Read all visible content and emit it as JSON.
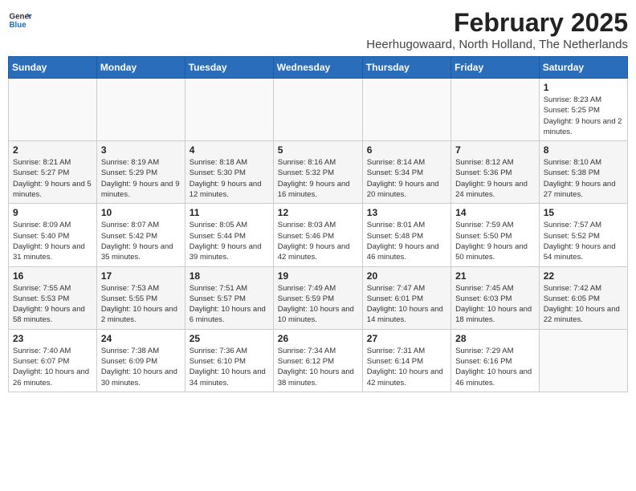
{
  "header": {
    "logo_general": "General",
    "logo_blue": "Blue",
    "main_title": "February 2025",
    "subtitle": "Heerhugowaard, North Holland, The Netherlands"
  },
  "weekdays": [
    "Sunday",
    "Monday",
    "Tuesday",
    "Wednesday",
    "Thursday",
    "Friday",
    "Saturday"
  ],
  "weeks": [
    [
      {
        "day": "",
        "info": ""
      },
      {
        "day": "",
        "info": ""
      },
      {
        "day": "",
        "info": ""
      },
      {
        "day": "",
        "info": ""
      },
      {
        "day": "",
        "info": ""
      },
      {
        "day": "",
        "info": ""
      },
      {
        "day": "1",
        "info": "Sunrise: 8:23 AM\nSunset: 5:25 PM\nDaylight: 9 hours and 2 minutes."
      }
    ],
    [
      {
        "day": "2",
        "info": "Sunrise: 8:21 AM\nSunset: 5:27 PM\nDaylight: 9 hours and 5 minutes."
      },
      {
        "day": "3",
        "info": "Sunrise: 8:19 AM\nSunset: 5:29 PM\nDaylight: 9 hours and 9 minutes."
      },
      {
        "day": "4",
        "info": "Sunrise: 8:18 AM\nSunset: 5:30 PM\nDaylight: 9 hours and 12 minutes."
      },
      {
        "day": "5",
        "info": "Sunrise: 8:16 AM\nSunset: 5:32 PM\nDaylight: 9 hours and 16 minutes."
      },
      {
        "day": "6",
        "info": "Sunrise: 8:14 AM\nSunset: 5:34 PM\nDaylight: 9 hours and 20 minutes."
      },
      {
        "day": "7",
        "info": "Sunrise: 8:12 AM\nSunset: 5:36 PM\nDaylight: 9 hours and 24 minutes."
      },
      {
        "day": "8",
        "info": "Sunrise: 8:10 AM\nSunset: 5:38 PM\nDaylight: 9 hours and 27 minutes."
      }
    ],
    [
      {
        "day": "9",
        "info": "Sunrise: 8:09 AM\nSunset: 5:40 PM\nDaylight: 9 hours and 31 minutes."
      },
      {
        "day": "10",
        "info": "Sunrise: 8:07 AM\nSunset: 5:42 PM\nDaylight: 9 hours and 35 minutes."
      },
      {
        "day": "11",
        "info": "Sunrise: 8:05 AM\nSunset: 5:44 PM\nDaylight: 9 hours and 39 minutes."
      },
      {
        "day": "12",
        "info": "Sunrise: 8:03 AM\nSunset: 5:46 PM\nDaylight: 9 hours and 42 minutes."
      },
      {
        "day": "13",
        "info": "Sunrise: 8:01 AM\nSunset: 5:48 PM\nDaylight: 9 hours and 46 minutes."
      },
      {
        "day": "14",
        "info": "Sunrise: 7:59 AM\nSunset: 5:50 PM\nDaylight: 9 hours and 50 minutes."
      },
      {
        "day": "15",
        "info": "Sunrise: 7:57 AM\nSunset: 5:52 PM\nDaylight: 9 hours and 54 minutes."
      }
    ],
    [
      {
        "day": "16",
        "info": "Sunrise: 7:55 AM\nSunset: 5:53 PM\nDaylight: 9 hours and 58 minutes."
      },
      {
        "day": "17",
        "info": "Sunrise: 7:53 AM\nSunset: 5:55 PM\nDaylight: 10 hours and 2 minutes."
      },
      {
        "day": "18",
        "info": "Sunrise: 7:51 AM\nSunset: 5:57 PM\nDaylight: 10 hours and 6 minutes."
      },
      {
        "day": "19",
        "info": "Sunrise: 7:49 AM\nSunset: 5:59 PM\nDaylight: 10 hours and 10 minutes."
      },
      {
        "day": "20",
        "info": "Sunrise: 7:47 AM\nSunset: 6:01 PM\nDaylight: 10 hours and 14 minutes."
      },
      {
        "day": "21",
        "info": "Sunrise: 7:45 AM\nSunset: 6:03 PM\nDaylight: 10 hours and 18 minutes."
      },
      {
        "day": "22",
        "info": "Sunrise: 7:42 AM\nSunset: 6:05 PM\nDaylight: 10 hours and 22 minutes."
      }
    ],
    [
      {
        "day": "23",
        "info": "Sunrise: 7:40 AM\nSunset: 6:07 PM\nDaylight: 10 hours and 26 minutes."
      },
      {
        "day": "24",
        "info": "Sunrise: 7:38 AM\nSunset: 6:09 PM\nDaylight: 10 hours and 30 minutes."
      },
      {
        "day": "25",
        "info": "Sunrise: 7:36 AM\nSunset: 6:10 PM\nDaylight: 10 hours and 34 minutes."
      },
      {
        "day": "26",
        "info": "Sunrise: 7:34 AM\nSunset: 6:12 PM\nDaylight: 10 hours and 38 minutes."
      },
      {
        "day": "27",
        "info": "Sunrise: 7:31 AM\nSunset: 6:14 PM\nDaylight: 10 hours and 42 minutes."
      },
      {
        "day": "28",
        "info": "Sunrise: 7:29 AM\nSunset: 6:16 PM\nDaylight: 10 hours and 46 minutes."
      },
      {
        "day": "",
        "info": ""
      }
    ]
  ]
}
